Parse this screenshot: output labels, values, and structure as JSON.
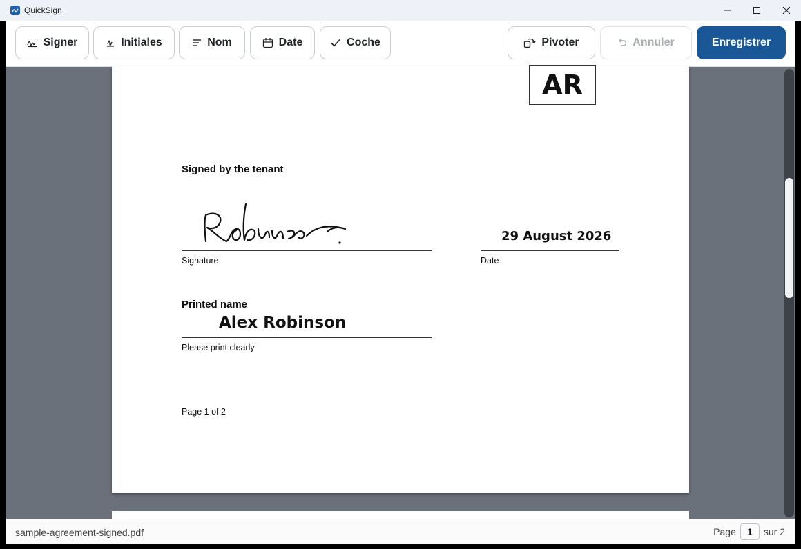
{
  "app": {
    "title": "QuickSign"
  },
  "toolbar": {
    "sign_label": "Signer",
    "initials_label": "Initiales",
    "name_label": "Nom",
    "date_label": "Date",
    "check_label": "Coche",
    "rotate_label": "Pivoter",
    "undo_label": "Annuler",
    "save_label": "Enregistrer"
  },
  "document": {
    "initials": "AR",
    "signed_heading": "Signed by the tenant",
    "signature_text": "Robinson",
    "signature_caption": "Signature",
    "date_value": "29 August 2026",
    "date_caption": "Date",
    "printed_name_heading": "Printed name",
    "printed_name_value": "Alex Robinson",
    "printed_name_caption": "Please print clearly",
    "page_footer": "Page 1 of 2"
  },
  "status": {
    "filename": "sample-agreement-signed.pdf",
    "page_label": "Page",
    "page_current": "1",
    "page_of": "sur 2"
  },
  "colors": {
    "accent": "#1a5796",
    "viewer_bg": "#6b717b"
  }
}
